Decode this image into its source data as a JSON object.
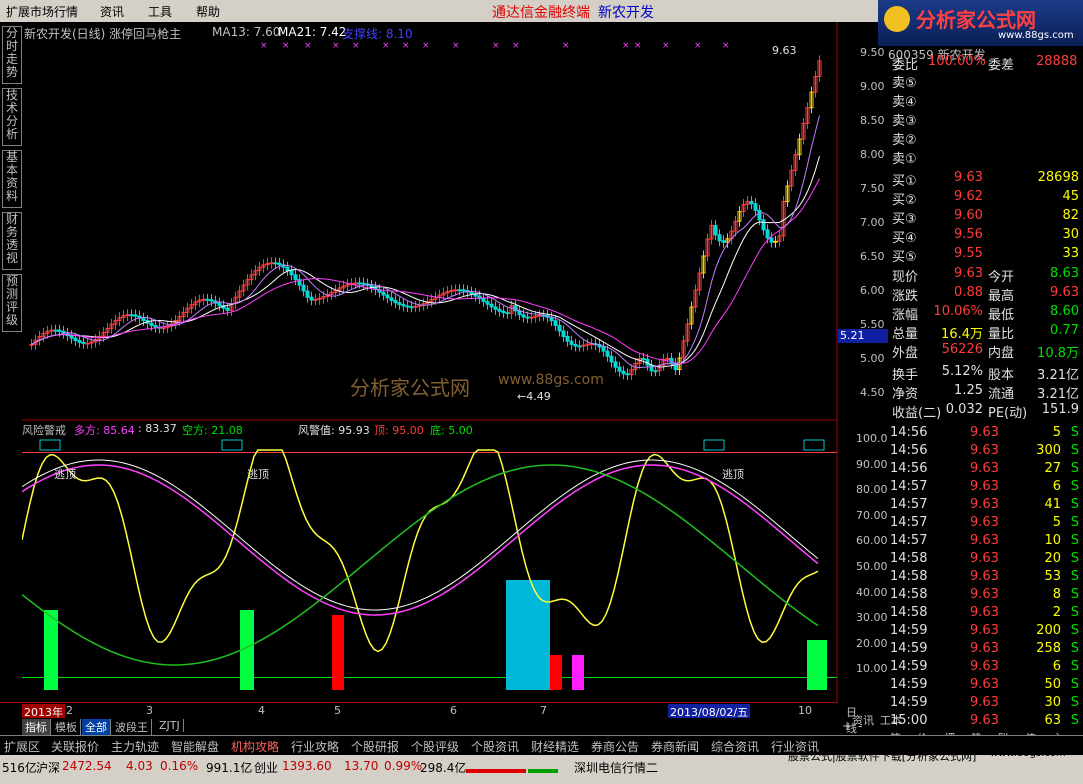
{
  "menu": {
    "items": [
      "扩展市场行情",
      "资讯",
      "工具",
      "帮助"
    ],
    "center_left": "通达信金融终端",
    "center_right": "新农开发"
  },
  "logo": {
    "text": "分析家公式网",
    "url": "www.88gs.com"
  },
  "side_tabs": [
    "分时走势",
    "技术分析",
    "基本资料",
    "财务透视",
    "预测评级"
  ],
  "main_chart": {
    "title": "新农开发(日线) 涨停回马枪主",
    "ma13_label": "MA13: 7.60",
    "ma21_label": "MA21: 7.42",
    "support_label": "支撑线: 8.10",
    "high_label": "9.63",
    "low_label": "4.49",
    "watermark": "分析家公式网",
    "watermark_url": "www.88gs.com",
    "price_tag": "5.21",
    "axis_ticks": [
      "9.50",
      "9.00",
      "8.50",
      "8.00",
      "7.50",
      "7.00",
      "6.50",
      "6.00",
      "5.50",
      "5.00",
      "4.50"
    ]
  },
  "sub_chart": {
    "name": "风险警戒",
    "duo_label": "多方: 85.64",
    "mid_label": ": 83.37",
    "kong_label": "空方: 21.08",
    "warn_label": "风警值: 95.93",
    "top_label": "顶: 95.00",
    "bottom_label": "底: 5.00",
    "tao_labels": [
      "逃顶",
      "逃顶",
      "逃顶"
    ],
    "axis_ticks": [
      "100.0",
      "90.00",
      "80.00",
      "70.00",
      "60.00",
      "50.00",
      "40.00",
      "30.00",
      "20.00",
      "10.00"
    ]
  },
  "date_axis": {
    "labels": [
      "2013年",
      "2",
      "3",
      "4",
      "5",
      "6",
      "7",
      "2013/08/02/五",
      "10"
    ],
    "period": "日线",
    "zoom": [
      "+",
      "-"
    ]
  },
  "bottom_tabs": [
    "指标",
    "模板",
    "全部",
    "波段王",
    "ZJTJ"
  ],
  "nav_tabs": [
    "扩展区",
    "关联报价",
    "主力轨迹",
    "智能解盘",
    "机构攻略",
    "行业攻略",
    "个股研报",
    "个股评级",
    "个股资讯",
    "财经精选",
    "券商公告",
    "券商新闻",
    "综合资讯",
    "行业资讯"
  ],
  "panel": {
    "stock_code": "600359 新农开发",
    "weibi_label": "委比",
    "weibi_value": "100.00%",
    "weicha_label": "委差",
    "weicha_value": "28888",
    "sell": [
      {
        "label": "卖⑤"
      },
      {
        "label": "卖④"
      },
      {
        "label": "卖③"
      },
      {
        "label": "卖②"
      },
      {
        "label": "卖①"
      }
    ],
    "buy": [
      {
        "label": "买①",
        "price": "9.63",
        "vol": "28698"
      },
      {
        "label": "买②",
        "price": "9.62",
        "vol": "45"
      },
      {
        "label": "买③",
        "price": "9.60",
        "vol": "82"
      },
      {
        "label": "买④",
        "price": "9.56",
        "vol": "30"
      },
      {
        "label": "买⑤",
        "price": "9.55",
        "vol": "33"
      }
    ],
    "quote": [
      {
        "l1": "现价",
        "v1": "9.63",
        "c1": "red",
        "l2": "今开",
        "v2": "8.63",
        "c2": "grn"
      },
      {
        "l1": "涨跌",
        "v1": "0.88",
        "c1": "red",
        "l2": "最高",
        "v2": "9.63",
        "c2": "red"
      },
      {
        "l1": "涨幅",
        "v1": "10.06%",
        "c1": "red",
        "l2": "最低",
        "v2": "8.60",
        "c2": "grn"
      },
      {
        "l1": "总量",
        "v1": "16.4万",
        "c1": "yel",
        "l2": "量比",
        "v2": "0.77",
        "c2": "grn"
      },
      {
        "l1": "外盘",
        "v1": "56226",
        "c1": "red",
        "l2": "内盘",
        "v2": "10.8万",
        "c2": "grn"
      }
    ],
    "fundamentals": [
      {
        "l1": "换手",
        "v1": "5.12%",
        "l2": "股本",
        "v2": "3.21亿"
      },
      {
        "l1": "净资",
        "v1": "1.25",
        "l2": "流通",
        "v2": "3.21亿"
      },
      {
        "l1": "收益(二)",
        "v1": "0.032",
        "l2": "PE(动)",
        "v2": "151.9"
      }
    ],
    "ticks": [
      {
        "t": "14:56",
        "p": "9.63",
        "v": "5",
        "s": "S"
      },
      {
        "t": "14:56",
        "p": "9.63",
        "v": "300",
        "s": "S"
      },
      {
        "t": "14:56",
        "p": "9.63",
        "v": "27",
        "s": "S"
      },
      {
        "t": "14:57",
        "p": "9.63",
        "v": "6",
        "s": "S"
      },
      {
        "t": "14:57",
        "p": "9.63",
        "v": "41",
        "s": "S"
      },
      {
        "t": "14:57",
        "p": "9.63",
        "v": "5",
        "s": "S"
      },
      {
        "t": "14:57",
        "p": "9.63",
        "v": "10",
        "s": "S"
      },
      {
        "t": "14:58",
        "p": "9.63",
        "v": "20",
        "s": "S"
      },
      {
        "t": "14:58",
        "p": "9.63",
        "v": "53",
        "s": "S"
      },
      {
        "t": "14:58",
        "p": "9.63",
        "v": "8",
        "s": "S"
      },
      {
        "t": "14:58",
        "p": "9.63",
        "v": "2",
        "s": "S"
      },
      {
        "t": "14:59",
        "p": "9.63",
        "v": "200",
        "s": "S"
      },
      {
        "t": "14:59",
        "p": "9.63",
        "v": "258",
        "s": "S"
      },
      {
        "t": "14:59",
        "p": "9.63",
        "v": "6",
        "s": "S"
      },
      {
        "t": "14:59",
        "p": "9.63",
        "v": "50",
        "s": "S"
      },
      {
        "t": "14:59",
        "p": "9.63",
        "v": "30",
        "s": "S"
      },
      {
        "t": "15:00",
        "p": "9.63",
        "v": "63",
        "s": "S"
      }
    ],
    "bottom_tabs": [
      "资讯",
      "工本"
    ],
    "mini_tabs": [
      "笔",
      "价",
      "细",
      "势",
      "联",
      "值",
      "主"
    ]
  },
  "status": {
    "index1": "516亿",
    "sh_label": "沪深",
    "sh_value": "2472.54",
    "sh_change": "4.03",
    "sh_pct": "0.16%",
    "sh_amount": "991.1亿",
    "cy_label": "创业",
    "cy_value": "1393.60",
    "cy_change": "13.70",
    "cy_pct": "0.99%",
    "cy_amount": "298.4亿",
    "server": "深圳电信行情二",
    "ad": "股票公式|股票软件下载[分析家公式网]",
    "ad_url": "www.88gs.com"
  },
  "colors": {
    "red": "#ff3c3c",
    "green": "#00e000",
    "yellow": "#ffff00",
    "magenta": "#ff40ff",
    "bg": "#000000"
  }
}
